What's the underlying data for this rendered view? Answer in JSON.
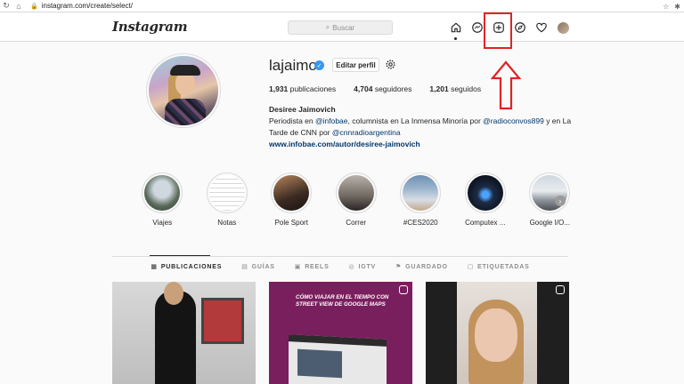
{
  "browser": {
    "url": "instagram.com/create/select/"
  },
  "header": {
    "logo": "Instagram",
    "search_placeholder": "Buscar"
  },
  "profile": {
    "username": "lajaimo",
    "edit_button": "Editar perfil",
    "stats": {
      "posts_count": "1,931",
      "posts_label": "publicaciones",
      "followers_count": "4,704",
      "followers_label": "seguidores",
      "following_count": "1,201",
      "following_label": "seguidos"
    },
    "bio": {
      "full_name": "Desiree Jaimovich",
      "line1_a": "Periodista en ",
      "mention1": "@infobae",
      "line1_b": ", columnista en La Inmensa Minoría por ",
      "mention2": "@radioconvos899",
      "line1_c": " y en La Tarde de CNN por ",
      "mention3": "@cnnradioargentina",
      "website": "www.infobae.com/autor/desiree-jaimovich"
    }
  },
  "highlights": [
    {
      "label": "Viajes"
    },
    {
      "label": "Notas"
    },
    {
      "label": "Pole Sport"
    },
    {
      "label": "Correr"
    },
    {
      "label": "#CES2020"
    },
    {
      "label": "Computex ..."
    },
    {
      "label": "Google I/O..."
    }
  ],
  "tabs": [
    {
      "label": "PUBLICACIONES",
      "icon": "grid-icon"
    },
    {
      "label": "GUÍAS",
      "icon": "guide-icon"
    },
    {
      "label": "REELS",
      "icon": "reels-icon"
    },
    {
      "label": "IGTV",
      "icon": "igtv-icon"
    },
    {
      "label": "GUARDADO",
      "icon": "bookmark-icon"
    },
    {
      "label": "ETIQUETADAS",
      "icon": "tag-icon"
    }
  ],
  "posts": [
    {
      "caption": ""
    },
    {
      "caption": "CÓMO VIAJAR EN EL TIEMPO CON STREET VIEW DE GOOGLE MAPS"
    },
    {
      "caption": ""
    }
  ],
  "colors": {
    "annotation": "#e02424",
    "link": "#00376b",
    "verified": "#3897f0"
  }
}
